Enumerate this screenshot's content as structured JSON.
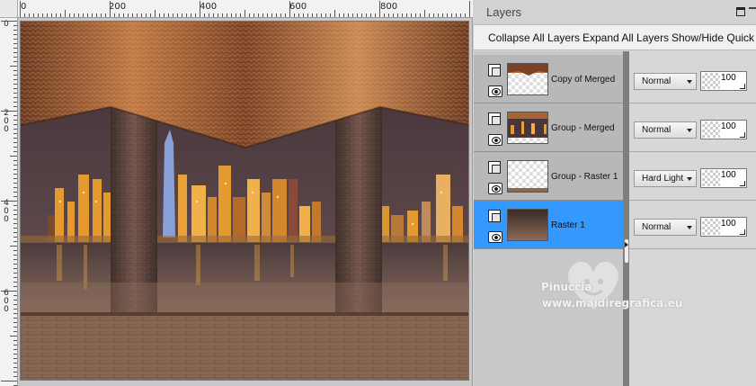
{
  "canvas": {
    "ruler_h_labels": [
      "0",
      "200",
      "400",
      "600",
      "800"
    ],
    "ruler_v_labels": [
      "0",
      "2\n0\n0",
      "4\n0\n0",
      "6\n0\n0"
    ]
  },
  "layers_panel": {
    "title": "Layers",
    "toolbar": {
      "collapse_label": "Collapse All Layers",
      "expand_label": "Expand All Layers",
      "showhide_label": "Show/Hide Quick S"
    },
    "layers": [
      {
        "name": "Copy of Merged",
        "blend_mode": "Normal",
        "opacity": "100",
        "selected": false
      },
      {
        "name": "Group - Merged",
        "blend_mode": "Normal",
        "opacity": "100",
        "selected": false
      },
      {
        "name": "Group - Raster 1",
        "blend_mode": "Hard Light",
        "opacity": "100",
        "selected": false
      },
      {
        "name": "Raster 1",
        "blend_mode": "Normal",
        "opacity": "100",
        "selected": true
      }
    ]
  },
  "watermark": {
    "name": "Pinuccia",
    "url": "www.maidiregrafica.eu"
  },
  "colors": {
    "selection": "#3399ff",
    "canvas_brown": "#6b4a3c",
    "curtain": "#b06a3a"
  }
}
